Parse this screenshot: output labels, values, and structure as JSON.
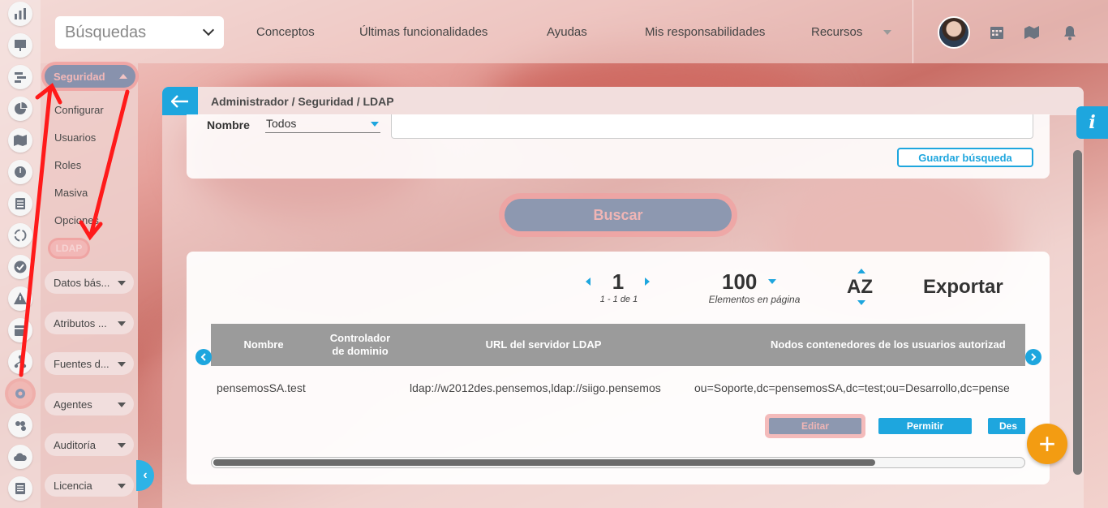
{
  "topbar": {
    "search_label": "Búsquedas",
    "nav": [
      "Conceptos",
      "Últimas funcionalidades",
      "Ayudas",
      "Mis responsabilidades",
      "Recursos"
    ]
  },
  "sidebar": {
    "section_label": "Seguridad",
    "sub_items": [
      "Configurar",
      "Usuarios",
      "Roles",
      "Masiva",
      "Opciones"
    ],
    "active_item": "LDAP",
    "groups": [
      "Datos bás...",
      "Atributos ...",
      "Fuentes d...",
      "Agentes",
      "Auditoría",
      "Licencia"
    ]
  },
  "breadcrumb": "Administrador / Seguridad / LDAP",
  "filter": {
    "label": "Nombre",
    "select_value": "Todos",
    "save_label": "Guardar búsqueda"
  },
  "search_button": "Buscar",
  "pagination": {
    "page": "1",
    "range": "1 - 1 de 1",
    "per_page": "100",
    "per_page_label": "Elementos en página",
    "sort": "AZ",
    "export": "Exportar"
  },
  "table": {
    "headers": [
      "Nombre",
      "Controlador de dominio",
      "URL del servidor LDAP",
      "Nodos contenedores de los usuarios autorizad"
    ],
    "row": {
      "name": "pensemosSA.test",
      "controller": "",
      "url": "ldap://w2012des.pensemos,ldap://siigo.pensemos",
      "nodes": "ou=Soporte,dc=pensemosSA,dc=test;ou=Desarrollo,dc=pense"
    },
    "actions": [
      "Editar",
      "Permitir",
      "Des"
    ]
  },
  "info_label": "i",
  "fab_label": "+",
  "colors": {
    "accent": "#1ea6de",
    "fab": "#f39c12",
    "highlight": "#f0a0a0",
    "annotation": "#ff0000"
  }
}
